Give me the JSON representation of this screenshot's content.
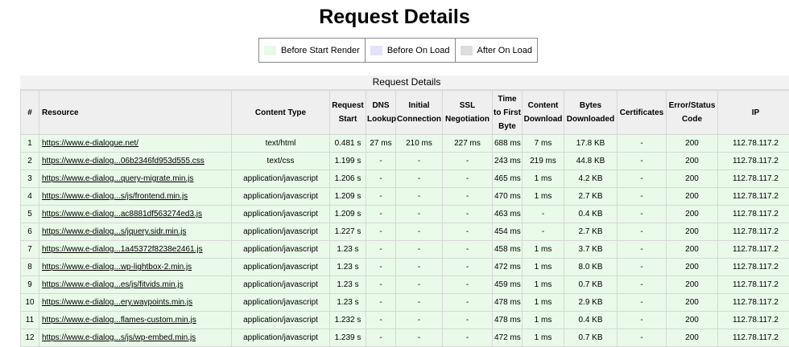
{
  "page": {
    "title": "Request Details"
  },
  "legend": {
    "items": [
      {
        "label": "Before Start Render",
        "color": "#e6fbe5"
      },
      {
        "label": "Before On Load",
        "color": "#e1e2fb"
      },
      {
        "label": "After On Load",
        "color": "#dcdcdc"
      }
    ]
  },
  "table": {
    "caption": "Request Details",
    "row_color": "#e9fbe8",
    "headers": [
      "#",
      "Resource",
      "Content Type",
      "Request Start",
      "DNS Lookup",
      "Initial Connection",
      "SSL Negotiation",
      "Time to First Byte",
      "Content Download",
      "Bytes Downloaded",
      "Certificates",
      "Error/Status Code",
      "IP"
    ],
    "rows": [
      {
        "num": "1",
        "resource": "https://www.e-dialogue.net/",
        "type": "text/html",
        "start": "0.481 s",
        "dns": "27 ms",
        "conn": "210 ms",
        "ssl": "227 ms",
        "ttfb": "688 ms",
        "download": "7 ms",
        "bytes": "17.8 KB",
        "cert": "-",
        "status": "200",
        "ip": "112.78.117.2"
      },
      {
        "num": "2",
        "resource": "https://www.e-dialog...06b2346fd953d555.css",
        "type": "text/css",
        "start": "1.199 s",
        "dns": "-",
        "conn": "-",
        "ssl": "-",
        "ttfb": "243 ms",
        "download": "219 ms",
        "bytes": "44.8 KB",
        "cert": "-",
        "status": "200",
        "ip": "112.78.117.2"
      },
      {
        "num": "3",
        "resource": "https://www.e-dialog...query-migrate.min.js",
        "type": "application/javascript",
        "start": "1.206 s",
        "dns": "-",
        "conn": "-",
        "ssl": "-",
        "ttfb": "465 ms",
        "download": "1 ms",
        "bytes": "4.2 KB",
        "cert": "-",
        "status": "200",
        "ip": "112.78.117.2"
      },
      {
        "num": "4",
        "resource": "https://www.e-dialog...s/js/frontend.min.js",
        "type": "application/javascript",
        "start": "1.209 s",
        "dns": "-",
        "conn": "-",
        "ssl": "-",
        "ttfb": "470 ms",
        "download": "1 ms",
        "bytes": "2.7 KB",
        "cert": "-",
        "status": "200",
        "ip": "112.78.117.2"
      },
      {
        "num": "5",
        "resource": "https://www.e-dialog...ac8881df563274ed3.js",
        "type": "application/javascript",
        "start": "1.209 s",
        "dns": "-",
        "conn": "-",
        "ssl": "-",
        "ttfb": "463 ms",
        "download": "-",
        "bytes": "0.4 KB",
        "cert": "-",
        "status": "200",
        "ip": "112.78.117.2"
      },
      {
        "num": "6",
        "resource": "https://www.e-dialog...s/jquery.sidr.min.js",
        "type": "application/javascript",
        "start": "1.227 s",
        "dns": "-",
        "conn": "-",
        "ssl": "-",
        "ttfb": "454 ms",
        "download": "-",
        "bytes": "2.7 KB",
        "cert": "-",
        "status": "200",
        "ip": "112.78.117.2"
      },
      {
        "num": "7",
        "resource": "https://www.e-dialog...1a45372f8238e2461.js",
        "type": "application/javascript",
        "start": "1.23 s",
        "dns": "-",
        "conn": "-",
        "ssl": "-",
        "ttfb": "458 ms",
        "download": "1 ms",
        "bytes": "3.7 KB",
        "cert": "-",
        "status": "200",
        "ip": "112.78.117.2"
      },
      {
        "num": "8",
        "resource": "https://www.e-dialog...wp-lightbox-2.min.js",
        "type": "application/javascript",
        "start": "1.23 s",
        "dns": "-",
        "conn": "-",
        "ssl": "-",
        "ttfb": "472 ms",
        "download": "1 ms",
        "bytes": "8.0 KB",
        "cert": "-",
        "status": "200",
        "ip": "112.78.117.2"
      },
      {
        "num": "9",
        "resource": "https://www.e-dialog...es/js/fitvids.min.js",
        "type": "application/javascript",
        "start": "1.23 s",
        "dns": "-",
        "conn": "-",
        "ssl": "-",
        "ttfb": "459 ms",
        "download": "1 ms",
        "bytes": "0.7 KB",
        "cert": "-",
        "status": "200",
        "ip": "112.78.117.2"
      },
      {
        "num": "10",
        "resource": "https://www.e-dialog...ery.waypoints.min.js",
        "type": "application/javascript",
        "start": "1.23 s",
        "dns": "-",
        "conn": "-",
        "ssl": "-",
        "ttfb": "478 ms",
        "download": "1 ms",
        "bytes": "2.9 KB",
        "cert": "-",
        "status": "200",
        "ip": "112.78.117.2"
      },
      {
        "num": "11",
        "resource": "https://www.e-dialog...flames-custom.min.js",
        "type": "application/javascript",
        "start": "1.232 s",
        "dns": "-",
        "conn": "-",
        "ssl": "-",
        "ttfb": "478 ms",
        "download": "1 ms",
        "bytes": "0.4 KB",
        "cert": "-",
        "status": "200",
        "ip": "112.78.117.2"
      },
      {
        "num": "12",
        "resource": "https://www.e-dialog...s/js/wp-embed.min.js",
        "type": "application/javascript",
        "start": "1.239 s",
        "dns": "-",
        "conn": "-",
        "ssl": "-",
        "ttfb": "472 ms",
        "download": "1 ms",
        "bytes": "0.7 KB",
        "cert": "-",
        "status": "200",
        "ip": "112.78.117.2"
      }
    ]
  }
}
